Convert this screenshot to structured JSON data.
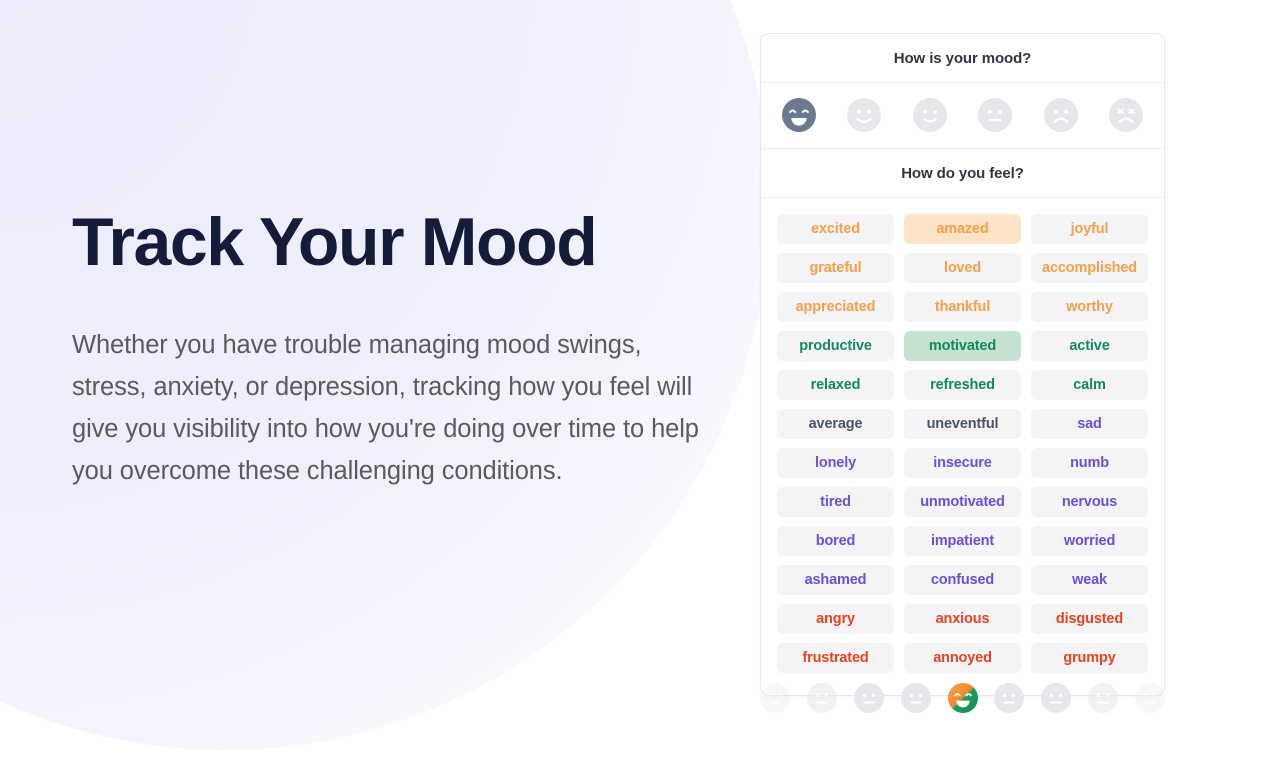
{
  "hero": {
    "title": "Track Your Mood",
    "description": "Whether you have trouble managing mood swings, stress, anxiety, or depression, tracking how you feel will give you visibility into how you're doing over time to help you overcome these challenging conditions."
  },
  "colors": {
    "heading_navy": "#141c3a",
    "body_gray": "#5b5b5b",
    "page_background": "#ffffff",
    "blob_lavender": "#eeeefc",
    "card_border": "#e6e7ea",
    "tag_background": "#f4f4f6",
    "orange": "#f5a04a",
    "orange_selected_bg": "#fde3c8",
    "green": "#138a5e",
    "green_selected_bg": "#c5e3d0",
    "gray": "#4b5565",
    "purple": "#6c4fd6",
    "red": "#e4441f",
    "face_selected": "#6b7a90",
    "face_idle": "#e6e7ea"
  },
  "mood_card": {
    "mood_heading": "How is your mood?",
    "feel_heading": "How do you feel?",
    "mood_faces": [
      {
        "icon": "face-grinning-icon",
        "selected": true
      },
      {
        "icon": "face-smiling-icon",
        "selected": false
      },
      {
        "icon": "face-slight-smile-icon",
        "selected": false
      },
      {
        "icon": "face-neutral-icon",
        "selected": false
      },
      {
        "icon": "face-frowning-icon",
        "selected": false
      },
      {
        "icon": "face-distressed-icon",
        "selected": false
      }
    ],
    "feelings": [
      {
        "label": "excited",
        "tone": "orange",
        "selected": false
      },
      {
        "label": "amazed",
        "tone": "orange",
        "selected": true
      },
      {
        "label": "joyful",
        "tone": "orange",
        "selected": false
      },
      {
        "label": "grateful",
        "tone": "orange",
        "selected": false
      },
      {
        "label": "loved",
        "tone": "orange",
        "selected": false
      },
      {
        "label": "accomplished",
        "tone": "orange",
        "selected": false
      },
      {
        "label": "appreciated",
        "tone": "orange",
        "selected": false
      },
      {
        "label": "thankful",
        "tone": "orange",
        "selected": false
      },
      {
        "label": "worthy",
        "tone": "orange",
        "selected": false
      },
      {
        "label": "productive",
        "tone": "green",
        "selected": false
      },
      {
        "label": "motivated",
        "tone": "green",
        "selected": true
      },
      {
        "label": "active",
        "tone": "green",
        "selected": false
      },
      {
        "label": "relaxed",
        "tone": "green",
        "selected": false
      },
      {
        "label": "refreshed",
        "tone": "green",
        "selected": false
      },
      {
        "label": "calm",
        "tone": "green",
        "selected": false
      },
      {
        "label": "average",
        "tone": "gray",
        "selected": false
      },
      {
        "label": "uneventful",
        "tone": "gray",
        "selected": false
      },
      {
        "label": "sad",
        "tone": "purple",
        "selected": false
      },
      {
        "label": "lonely",
        "tone": "purple",
        "selected": false
      },
      {
        "label": "insecure",
        "tone": "purple",
        "selected": false
      },
      {
        "label": "numb",
        "tone": "purple",
        "selected": false
      },
      {
        "label": "tired",
        "tone": "purple",
        "selected": false
      },
      {
        "label": "unmotivated",
        "tone": "purple",
        "selected": false
      },
      {
        "label": "nervous",
        "tone": "purple",
        "selected": false
      },
      {
        "label": "bored",
        "tone": "purple",
        "selected": false
      },
      {
        "label": "impatient",
        "tone": "purple",
        "selected": false
      },
      {
        "label": "worried",
        "tone": "purple",
        "selected": false
      },
      {
        "label": "ashamed",
        "tone": "purple",
        "selected": false
      },
      {
        "label": "confused",
        "tone": "purple",
        "selected": false
      },
      {
        "label": "weak",
        "tone": "purple",
        "selected": false
      },
      {
        "label": "angry",
        "tone": "red",
        "selected": false
      },
      {
        "label": "anxious",
        "tone": "red",
        "selected": false
      },
      {
        "label": "disgusted",
        "tone": "red",
        "selected": false
      },
      {
        "label": "frustrated",
        "tone": "red",
        "selected": false
      },
      {
        "label": "annoyed",
        "tone": "red",
        "selected": false
      },
      {
        "label": "grumpy",
        "tone": "red",
        "selected": false
      }
    ]
  },
  "carousel": {
    "faces": [
      {
        "icon": "face-neutral-icon",
        "state": "faded-most",
        "highlighted": false
      },
      {
        "icon": "face-neutral-icon",
        "state": "faded-more",
        "highlighted": false
      },
      {
        "icon": "face-neutral-icon",
        "state": "normal",
        "highlighted": false
      },
      {
        "icon": "face-neutral-icon",
        "state": "normal",
        "highlighted": false
      },
      {
        "icon": "face-grinning-icon",
        "state": "normal",
        "highlighted": true
      },
      {
        "icon": "face-neutral-icon",
        "state": "normal",
        "highlighted": false
      },
      {
        "icon": "face-neutral-icon",
        "state": "normal",
        "highlighted": false
      },
      {
        "icon": "face-neutral-icon",
        "state": "faded-more",
        "highlighted": false
      },
      {
        "icon": "face-neutral-icon",
        "state": "faded-most",
        "highlighted": false
      }
    ]
  }
}
